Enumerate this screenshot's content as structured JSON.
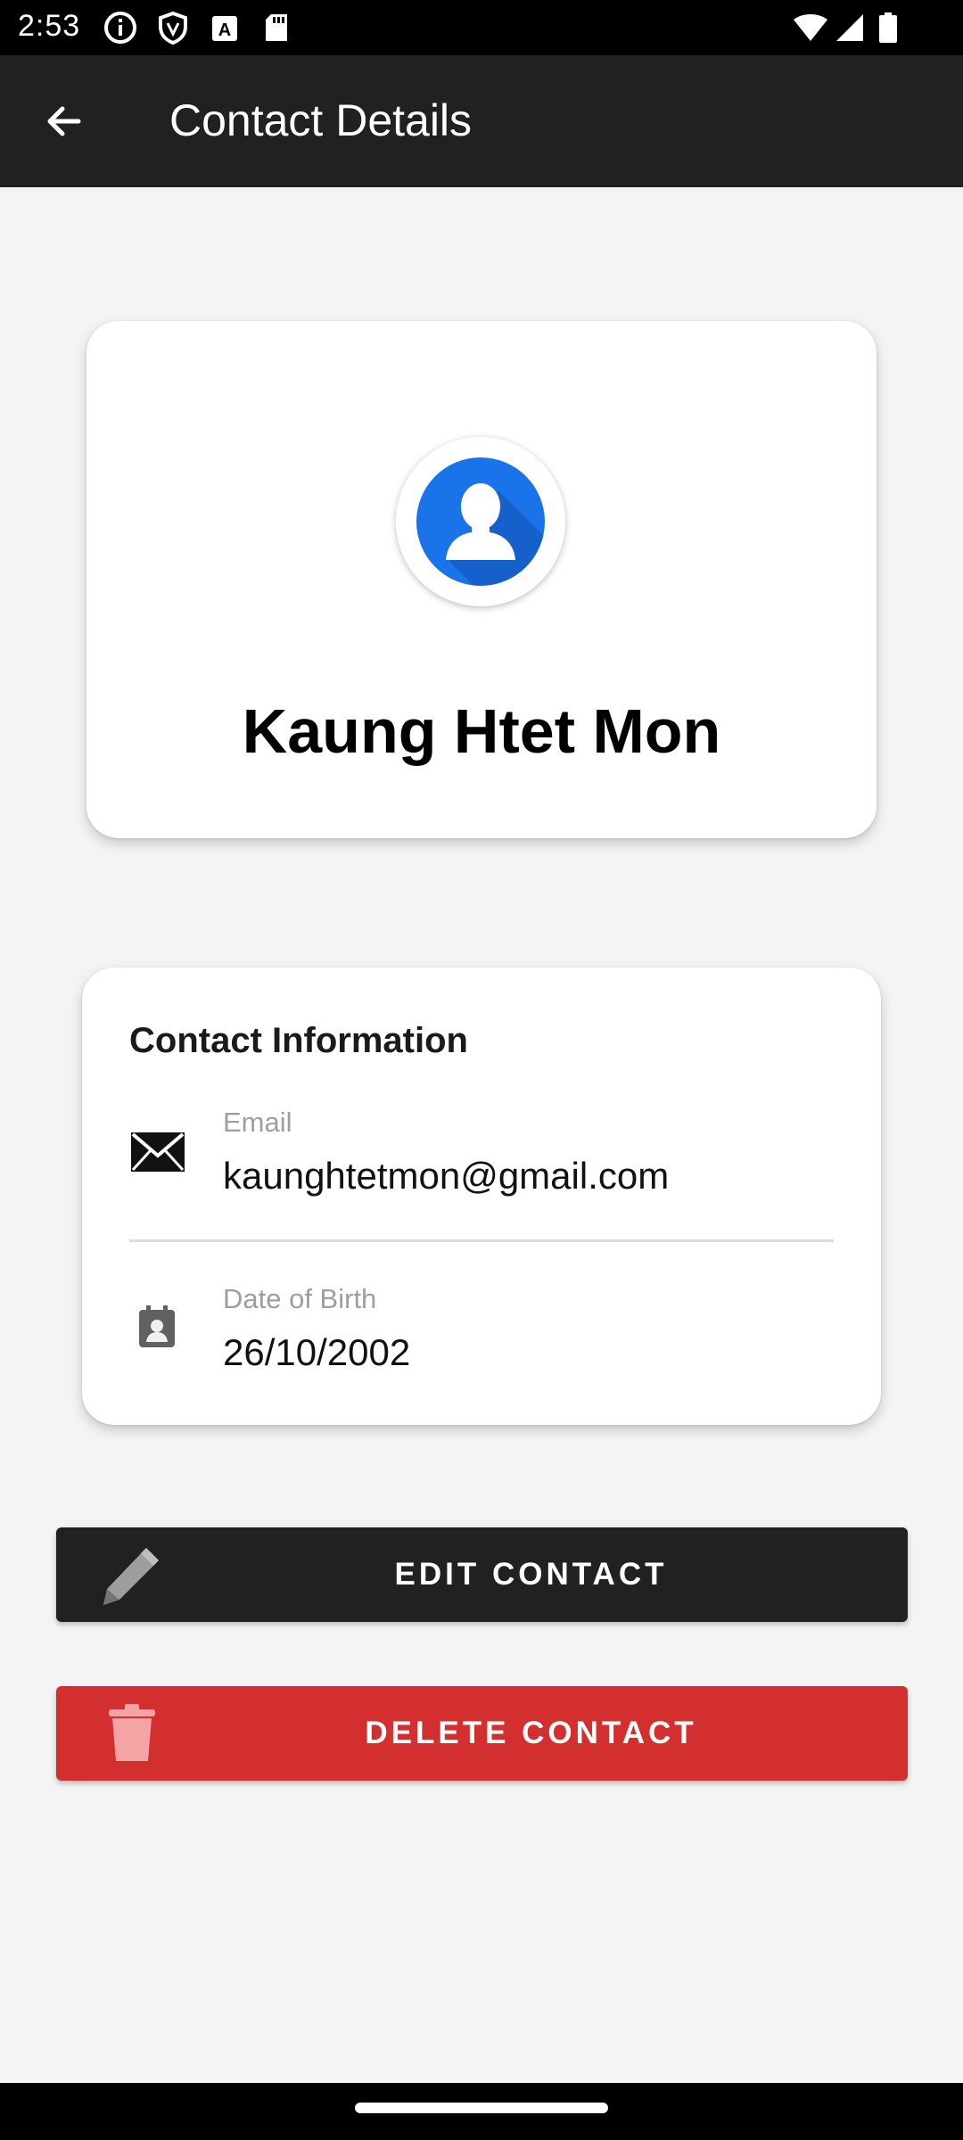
{
  "status_bar": {
    "time": "2:53",
    "icons": [
      "info-icon",
      "shield-icon",
      "a-box-icon",
      "sd-card-icon",
      "wifi-icon",
      "signal-icon",
      "battery-icon"
    ]
  },
  "app_bar": {
    "title": "Contact Details",
    "back_icon": "arrow-back-icon"
  },
  "profile": {
    "name": "Kaung Htet Mon",
    "avatar_icon": "person-avatar-icon"
  },
  "contact_info": {
    "title": "Contact Information",
    "email": {
      "label": "Email",
      "value": "kaunghtetmon@gmail.com",
      "icon": "envelope-icon"
    },
    "dob": {
      "label": "Date of Birth",
      "value": "26/10/2002",
      "icon": "calendar-contact-icon"
    }
  },
  "actions": {
    "edit_label": "EDIT CONTACT",
    "edit_icon": "pencil-icon",
    "delete_label": "DELETE CONTACT",
    "delete_icon": "trash-icon"
  },
  "colors": {
    "app_bar": "#212121",
    "background": "#f4f4f4",
    "avatar_blue": "#1a73e8",
    "delete_red": "#d32f2f",
    "edit_dark": "#212121"
  }
}
